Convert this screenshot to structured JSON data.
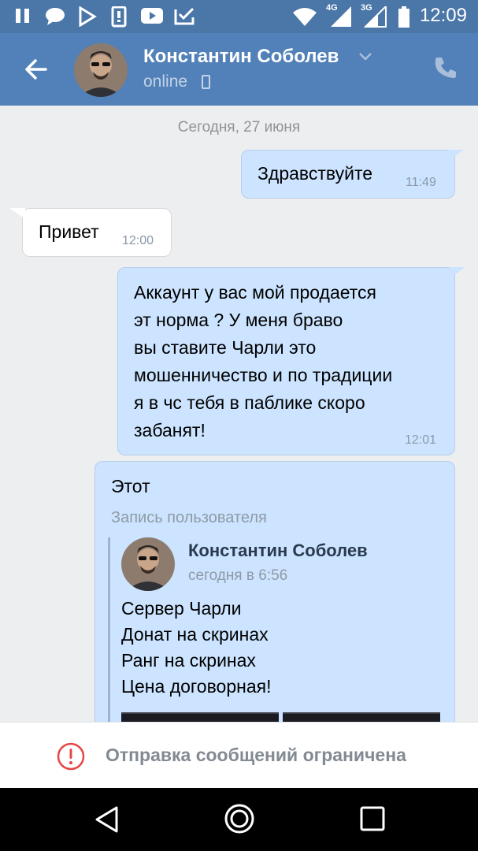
{
  "status_bar": {
    "time": "12:09",
    "net1": "4G",
    "net2": "3G",
    "icons": [
      "pause-icon",
      "chat-bubble-icon",
      "play-store-icon",
      "sim-card-icon",
      "youtube-icon",
      "tick-mail-icon",
      "wifi-icon",
      "signal-icon",
      "battery-icon"
    ]
  },
  "header": {
    "name": "Константин Соболев",
    "status": "online"
  },
  "chat": {
    "date": "Сегодня, 27 июня",
    "messages": [
      {
        "text": "Здравствуйте",
        "time": "11:49"
      },
      {
        "text": "Привет",
        "time": "12:00"
      },
      {
        "lines": [
          "Аккаунт у вас мой продается",
          "эт норма ? У меня браво",
          "вы ставите Чарли это",
          "мошенничество и по традиции",
          "я в чс тебя в паблике скоро",
          "забанят!"
        ],
        "time": "12:01"
      },
      {
        "text": "Этот",
        "repost_label": "Запись пользователя",
        "repost": {
          "author": "Константин Соболев",
          "time": "сегодня в 6:56",
          "lines": [
            "Сервер Чарли",
            "Донат на скринах",
            "Ранг на скринах",
            "Цена договорная!"
          ]
        }
      }
    ]
  },
  "footer": {
    "text": "Отправка сообщений ограничена"
  },
  "colors": {
    "header": "#5181b8",
    "status_bar": "#4a76a8",
    "outgoing_bubble": "#cce4ff",
    "incoming_bubble": "#ffffff",
    "warning": "#e64646"
  }
}
